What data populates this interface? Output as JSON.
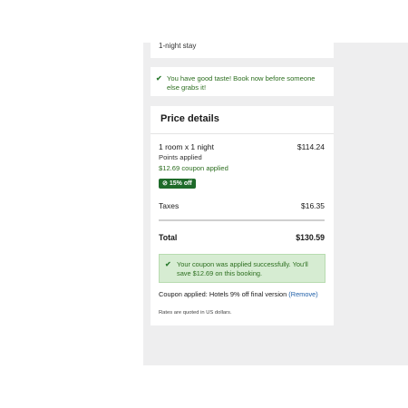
{
  "stay": {
    "text": "1-night stay"
  },
  "taste_message": {
    "text": "You have good taste! Book now before someone else grabs it!"
  },
  "price_details": {
    "title": "Price details",
    "room_label": "1 room x 1 night",
    "room_price": "$114.24",
    "points_text": "Points applied",
    "coupon_text": "$12.69 coupon applied",
    "badge_text": "15% off",
    "taxes_label": "Taxes",
    "taxes_value": "$16.35",
    "total_label": "Total",
    "total_value": "$130.59",
    "success_message": "Your coupon was applied successfully. You'll save $12.69 on this booking.",
    "coupon_applied_prefix": "Coupon applied: Hotels 9% off final version",
    "remove_label": "(Remove)",
    "rates_note": "Rates are quoted in US dollars."
  },
  "colors": {
    "success_green": "#2c6e1f",
    "badge_green": "#1f6b2a",
    "success_bg": "#d6ecd2",
    "link_blue": "#1f5fa8",
    "panel_gray": "#eeeeef"
  },
  "icons": {
    "check": "check-icon",
    "tag": "tag-icon"
  }
}
